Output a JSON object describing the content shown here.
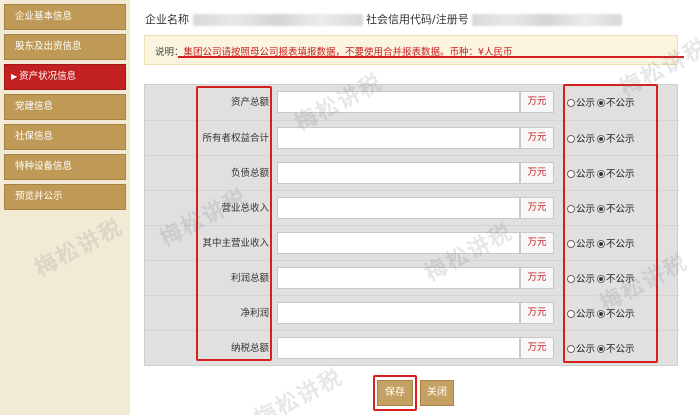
{
  "sidebar": {
    "items": [
      {
        "label": "企业基本信息",
        "active": false
      },
      {
        "label": "股东及出资信息",
        "active": false
      },
      {
        "label": "资产状况信息",
        "active": true
      },
      {
        "label": "党建信息",
        "active": false
      },
      {
        "label": "社保信息",
        "active": false
      },
      {
        "label": "特种设备信息",
        "active": false
      },
      {
        "label": "预览并公示",
        "active": false
      }
    ]
  },
  "header": {
    "company_label": "企业名称",
    "credit_label": "社会信用代码/注册号"
  },
  "notice": {
    "prefix": "说明：",
    "highlight": "集团公司请按照母公司报表填报数据，不要使用合并报表数据。币种：¥人民币"
  },
  "form": {
    "rows": [
      {
        "label": "资产总额",
        "unit": "万元",
        "value": "",
        "public_label": "公示",
        "private_label": "不公示",
        "selected": "不公示"
      },
      {
        "label": "所有者权益合计",
        "unit": "万元",
        "value": "",
        "public_label": "公示",
        "private_label": "不公示",
        "selected": "不公示"
      },
      {
        "label": "负债总额",
        "unit": "万元",
        "value": "",
        "public_label": "公示",
        "private_label": "不公示",
        "selected": "不公示"
      },
      {
        "label": "营业总收入",
        "unit": "万元",
        "value": "",
        "public_label": "公示",
        "private_label": "不公示",
        "selected": "不公示"
      },
      {
        "label": "其中主营业收入",
        "unit": "万元",
        "value": "",
        "public_label": "公示",
        "private_label": "不公示",
        "selected": "不公示"
      },
      {
        "label": "利润总额",
        "unit": "万元",
        "value": "",
        "public_label": "公示",
        "private_label": "不公示",
        "selected": "不公示"
      },
      {
        "label": "净利润",
        "unit": "万元",
        "value": "",
        "public_label": "公示",
        "private_label": "不公示",
        "selected": "不公示"
      },
      {
        "label": "纳税总额",
        "unit": "万元",
        "value": "",
        "public_label": "公示",
        "private_label": "不公示",
        "selected": "不公示"
      }
    ]
  },
  "actions": {
    "save_label": "保存",
    "close_label": "关闭"
  },
  "colors": {
    "sidebar_item": "#bf9a57",
    "sidebar_active": "#c32121",
    "annotation_red": "#d61f1f",
    "unit_text": "#c81e1e"
  }
}
